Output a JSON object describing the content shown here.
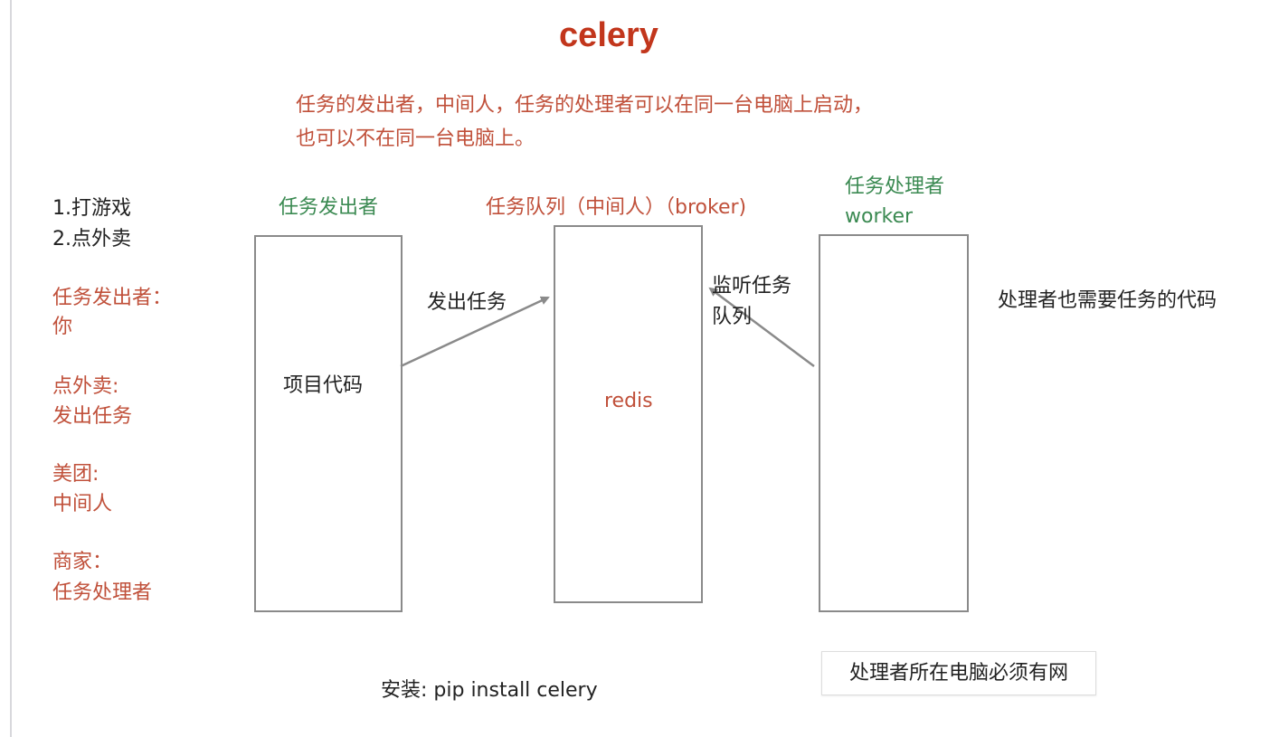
{
  "title": "celery",
  "note_lines": [
    "任务的发出者，中间人，任务的处理者可以在同一台电脑上启动，",
    "也可以不在同一台电脑上。"
  ],
  "left_list": {
    "items": [
      "1.打游戏",
      "2.点外卖"
    ],
    "pairs": [
      {
        "term": "任务发出者：",
        "value": "你"
      },
      {
        "term": "点外卖:",
        "value": "发出任务"
      },
      {
        "term": "美团:",
        "value": "中间人"
      },
      {
        "term": "商家：",
        "value": "任务处理者"
      }
    ]
  },
  "boxes": {
    "producer": {
      "label": "任务发出者",
      "content": "项目代码"
    },
    "broker": {
      "label": "任务队列（中间人）（broker)",
      "content": "redis"
    },
    "worker": {
      "label_lines": [
        "任务处理者",
        "worker"
      ]
    }
  },
  "arrows": {
    "send": "发出任务",
    "listen_lines": [
      "监听任务",
      "队列"
    ]
  },
  "worker_note": "处理者也需要任务的代码",
  "install": "安装: pip install celery",
  "network_note": "处理者所在电脑必须有网",
  "colors": {
    "title": "#c2361c",
    "red": "#c0503a",
    "green": "#3b8a52",
    "box": "#8a8a8a"
  }
}
